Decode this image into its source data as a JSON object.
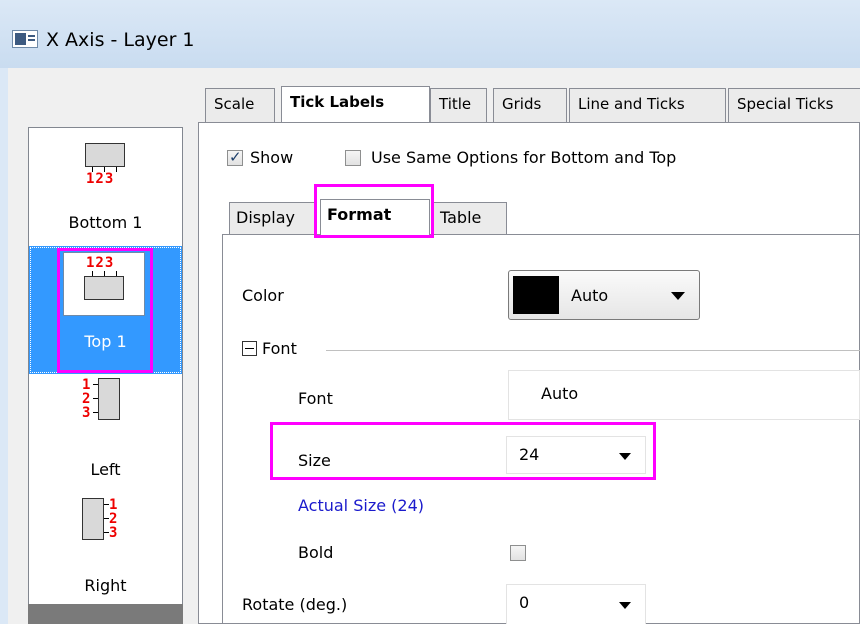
{
  "window": {
    "title": "X Axis - Layer 1"
  },
  "sidebar": {
    "items": [
      {
        "label": "Bottom 1",
        "digits": "123",
        "icon": "bottom-axis-icon"
      },
      {
        "label": "Top 1",
        "digits": "123",
        "icon": "top-axis-icon",
        "selected": true
      },
      {
        "label": "Left",
        "digits": [
          "1",
          "2",
          "3"
        ],
        "icon": "left-axis-icon"
      },
      {
        "label": "Right",
        "digits": [
          "1",
          "2",
          "3"
        ],
        "icon": "right-axis-icon"
      }
    ]
  },
  "tabs": [
    "Scale",
    "Tick Labels",
    "Title",
    "Grids",
    "Line and Ticks",
    "Special Ticks"
  ],
  "active_tab": "Tick Labels",
  "options": {
    "show_label": "Show",
    "show_checked": true,
    "same_options_label": "Use Same Options for Bottom and Top",
    "same_options_checked": false
  },
  "subtabs": [
    "Display",
    "Format",
    "Table"
  ],
  "active_subtab": "Format",
  "format": {
    "color_label": "Color",
    "color_value": "Auto",
    "color_swatch": "#000000",
    "font_group": "Font",
    "font_label": "Font",
    "font_value": "Auto",
    "size_label": "Size",
    "size_value": "24",
    "actual_size": "Actual Size (24)",
    "bold_label": "Bold",
    "bold_checked": false,
    "rotate_label": "Rotate (deg.)",
    "rotate_value": "0"
  },
  "colors": {
    "highlight": "#ff00ff",
    "selection": "#3399ff",
    "link": "#0000cc",
    "digits": "#e00000"
  }
}
